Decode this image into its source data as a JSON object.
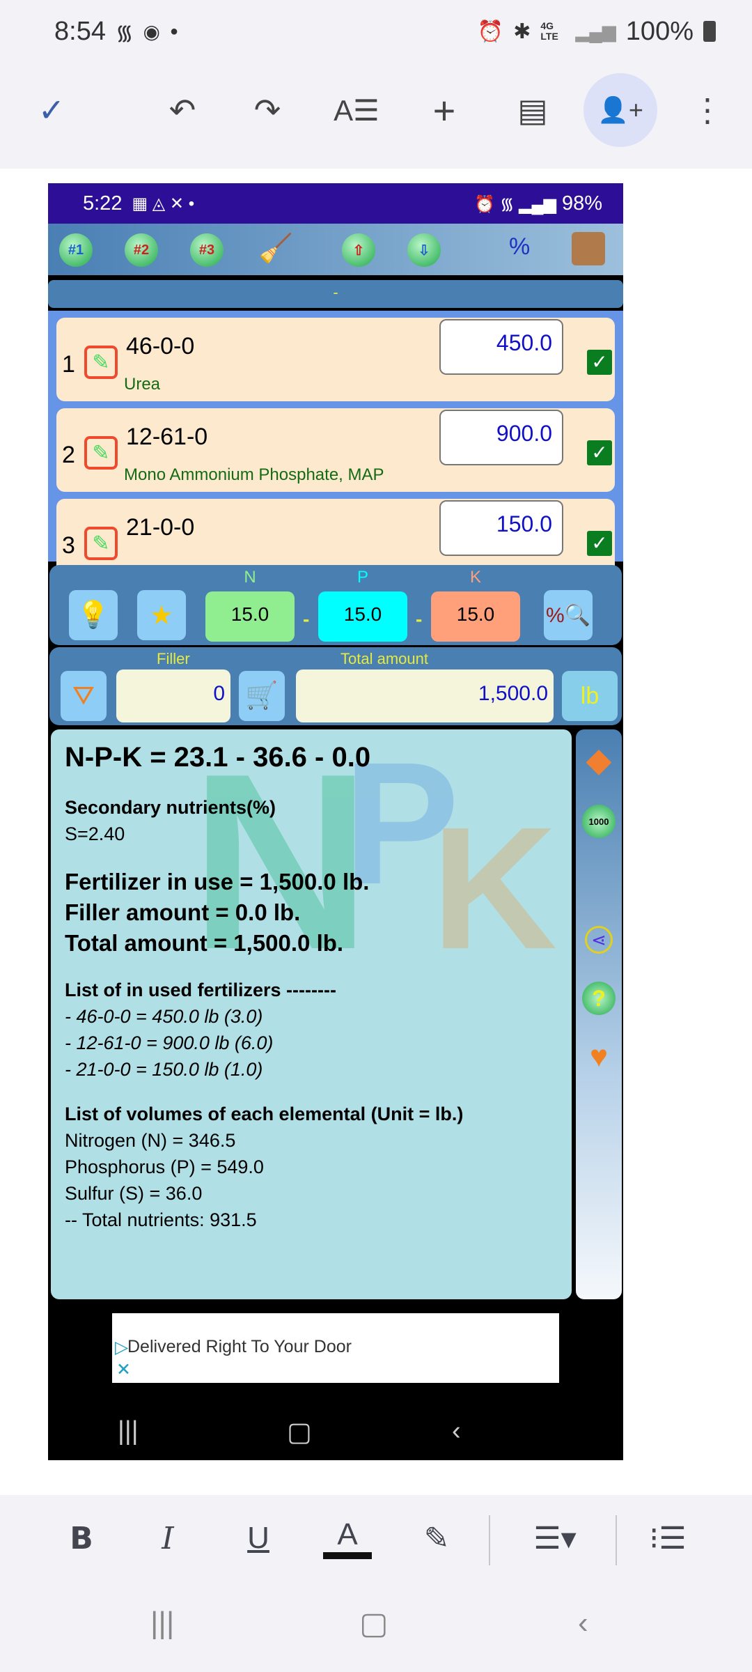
{
  "status_bar": {
    "time": "8:54",
    "battery": "100%",
    "network": "4G LTE"
  },
  "docs_toolbar": {
    "icons": [
      "check-icon",
      "undo-icon",
      "redo-icon",
      "text-format-icon",
      "insert-icon",
      "comment-icon",
      "share-person-add-icon",
      "more-vert-icon"
    ]
  },
  "inner_status": {
    "time": "5:22",
    "battery": "98%"
  },
  "app_toolbar": {
    "preset1": "#1",
    "preset2": "#2",
    "preset3": "#3"
  },
  "header_text": "-",
  "fertilizers": [
    {
      "index": "1",
      "code": "46-0-0",
      "name": "Urea",
      "amount": "450.0",
      "checked": true
    },
    {
      "index": "2",
      "code": "12-61-0",
      "name": "Mono Ammonium Phosphate, MAP",
      "amount": "900.0",
      "checked": true
    },
    {
      "index": "3",
      "code": "21-0-0",
      "name": "",
      "amount": "150.0",
      "checked": true
    }
  ],
  "target": {
    "n_label": "N",
    "p_label": "P",
    "k_label": "K",
    "n": "15.0",
    "p": "15.0",
    "k": "15.0",
    "sep": "-"
  },
  "amounts": {
    "filler_label": "Filler",
    "filler": "0",
    "total_label": "Total amount",
    "total": "1,500.0",
    "unit": "lb"
  },
  "results": {
    "npk": "N-P-K = 23.1 - 36.6 - 0.0",
    "secondary_title": "Secondary nutrients(%)",
    "secondary": "S=2.40",
    "in_use": "Fertilizer in use = 1,500.0 lb.",
    "filler": "Filler amount = 0.0 lb.",
    "total": "Total amount = 1,500.0 lb.",
    "list_title": "List of in used fertilizers --------",
    "list": [
      "- 46-0-0 = 450.0 lb (3.0)",
      "- 12-61-0 = 900.0 lb (6.0)",
      "- 21-0-0 = 150.0 lb (1.0)"
    ],
    "vol_title": "List of volumes of each elemental (Unit = lb.)",
    "vols": [
      "Nitrogen (N) = 346.5",
      "Phosphorus (P) = 549.0",
      "Sulfur (S) = 36.0",
      "-- Total nutrients: 931.5"
    ],
    "watermark": "NPK"
  },
  "side": {
    "thousand": "1000",
    "help": "?"
  },
  "ad": {
    "text": "Delivered Right To Your Door"
  },
  "format_toolbar": {
    "bold": "B",
    "italic": "I",
    "underline": "U",
    "text_color": "A"
  },
  "colors": {
    "n": "#90ee90",
    "p": "#00ffff",
    "k": "#ffa07a",
    "app_blue": "#4a7fb1",
    "results_bg": "#b1dfe6"
  }
}
